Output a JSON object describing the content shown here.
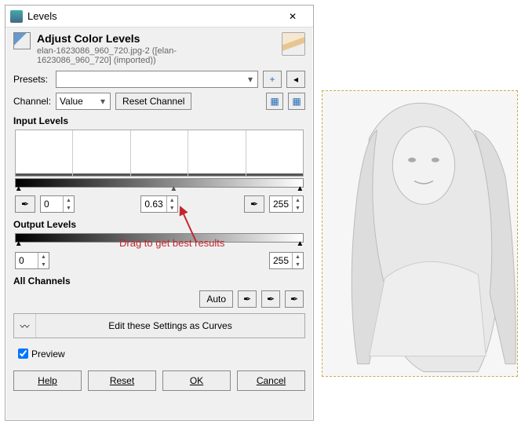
{
  "window": {
    "title": "Levels",
    "close_glyph": "✕"
  },
  "header": {
    "title": "Adjust Color Levels",
    "subtitle": "elan-1623086_960_720.jpg-2 ([elan-1623086_960_720] (imported))"
  },
  "presets": {
    "label": "Presets:",
    "value": "",
    "add_glyph": "+",
    "menu_glyph": "◂"
  },
  "channel": {
    "label": "Channel:",
    "value": "Value",
    "reset_btn": "Reset Channel"
  },
  "input_levels": {
    "label": "Input Levels",
    "low": "0",
    "gamma": "0.63",
    "high": "255"
  },
  "output_levels": {
    "label": "Output Levels",
    "low": "0",
    "high": "255"
  },
  "all_channels": {
    "label": "All Channels",
    "auto": "Auto"
  },
  "edit_curves": "Edit these Settings as Curves",
  "preview": {
    "label": "Preview",
    "checked": true
  },
  "footer": {
    "help": "Help",
    "reset": "Reset",
    "ok": "OK",
    "cancel": "Cancel"
  },
  "annotation": "Drag to get best results",
  "icons": {
    "eyedropper": "✒",
    "curve": "〰",
    "hist": "▦"
  }
}
